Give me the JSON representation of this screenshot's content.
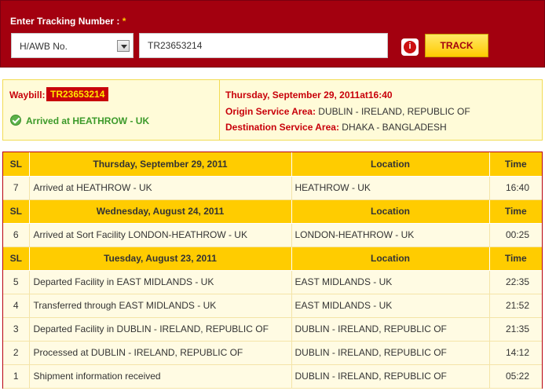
{
  "tracking": {
    "label": "Enter Tracking Number :",
    "required_mark": "*",
    "type_select": "H/AWB No.",
    "number_value": "TR23653214",
    "info_glyph": "i",
    "track_button": "TRACK"
  },
  "summary": {
    "waybill_label": "Waybill:",
    "waybill_number": "TR23653214",
    "status": "Arrived at HEATHROW - UK",
    "datetime": "Thursday, September 29, 2011at16:40",
    "origin_label": "Origin Service Area:",
    "origin_value": "DUBLIN - IRELAND, REPUBLIC OF",
    "destination_label": "Destination Service Area:",
    "destination_value": "DHAKA - BANGLADESH"
  },
  "columns": {
    "sl": "SL",
    "location": "Location",
    "time": "Time"
  },
  "groups": [
    {
      "date": "Thursday, September 29, 2011",
      "rows": [
        {
          "sl": "7",
          "event": "Arrived at HEATHROW - UK",
          "location": "HEATHROW - UK",
          "time": "16:40"
        }
      ]
    },
    {
      "date": "Wednesday, August 24, 2011",
      "rows": [
        {
          "sl": "6",
          "event": "Arrived at Sort Facility LONDON-HEATHROW - UK",
          "location": "LONDON-HEATHROW - UK",
          "time": "00:25"
        }
      ]
    },
    {
      "date": "Tuesday, August 23, 2011",
      "rows": [
        {
          "sl": "5",
          "event": "Departed Facility in EAST MIDLANDS - UK",
          "location": "EAST MIDLANDS - UK",
          "time": "22:35"
        },
        {
          "sl": "4",
          "event": "Transferred through EAST MIDLANDS - UK",
          "location": "EAST MIDLANDS - UK",
          "time": "21:52"
        },
        {
          "sl": "3",
          "event": "Departed Facility in DUBLIN - IRELAND, REPUBLIC OF",
          "location": "DUBLIN - IRELAND, REPUBLIC OF",
          "time": "21:35"
        },
        {
          "sl": "2",
          "event": "Processed at DUBLIN - IRELAND, REPUBLIC OF",
          "location": "DUBLIN - IRELAND, REPUBLIC OF",
          "time": "14:12"
        },
        {
          "sl": "1",
          "event": "Shipment information received",
          "location": "DUBLIN - IRELAND, REPUBLIC OF",
          "time": "05:22"
        }
      ]
    }
  ]
}
